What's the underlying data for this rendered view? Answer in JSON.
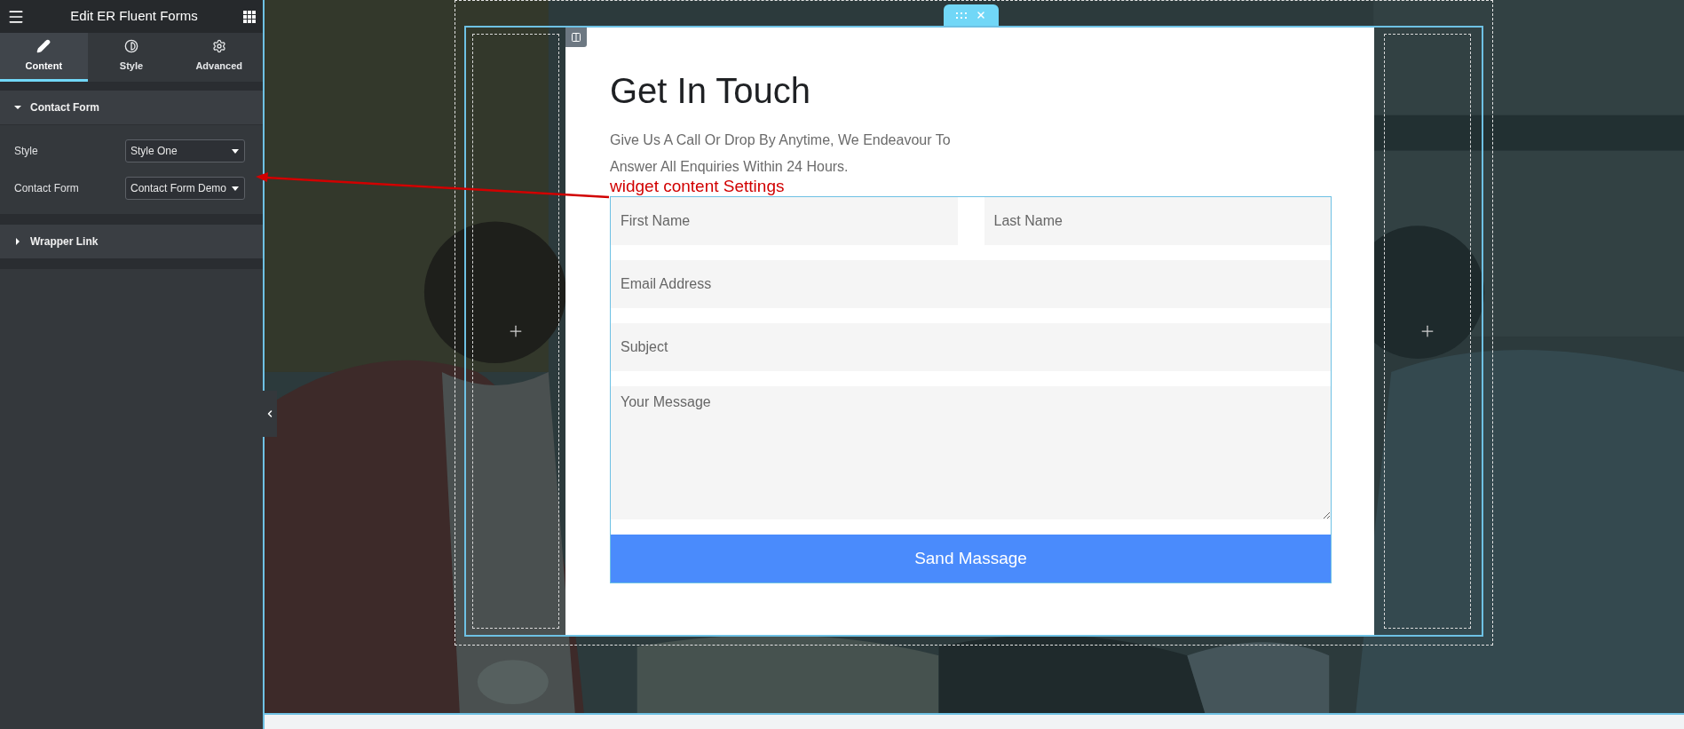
{
  "panel": {
    "title": "Edit ER Fluent Forms",
    "tabs": [
      {
        "label": "Content",
        "selected": true
      },
      {
        "label": "Style",
        "selected": false
      },
      {
        "label": "Advanced",
        "selected": false
      }
    ],
    "sections": [
      {
        "title": "Contact Form",
        "expanded": true,
        "controls": [
          {
            "label": "Style",
            "value": "Style One"
          },
          {
            "label": "Contact Form",
            "value": "Contact Form Demo"
          }
        ]
      },
      {
        "title": "Wrapper Link",
        "expanded": false
      }
    ]
  },
  "form": {
    "heading": "Get In Touch",
    "description_lines": [
      "Give Us A Call Or Drop By Anytime, We Endeavour To",
      "Answer All Enquiries Within 24 Hours."
    ],
    "field_rows": [
      [
        {
          "kind": "text",
          "placeholder": "First Name"
        },
        {
          "kind": "text",
          "placeholder": "Last Name"
        }
      ],
      [
        {
          "kind": "text",
          "placeholder": "Email Address"
        }
      ],
      [
        {
          "kind": "text",
          "placeholder": "Subject"
        }
      ],
      [
        {
          "kind": "textarea",
          "placeholder": "Your Message"
        }
      ]
    ],
    "submit": "Sand Massage"
  },
  "annotation": "widget content Settings"
}
